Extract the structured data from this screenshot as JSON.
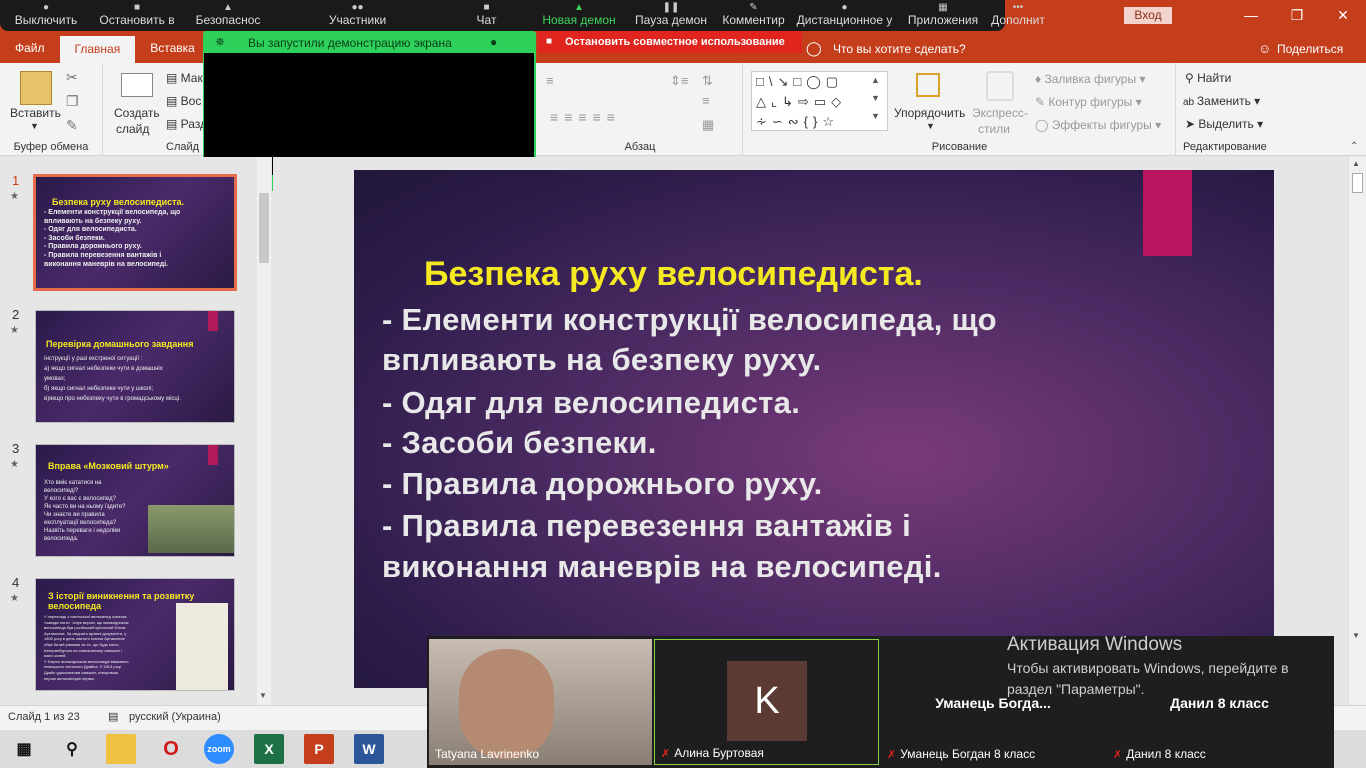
{
  "app": {
    "login": "Вход"
  },
  "zoom_toolbar": {
    "items": [
      "Выключить",
      "Остановить в",
      "Безопаснос",
      "Участники",
      "Чат",
      "Новая демон",
      "Пауза демон",
      "Комментир",
      "Дистанционное у",
      "Приложения",
      "Дополнит"
    ],
    "active_item": "Новая демон"
  },
  "share_bar": {
    "title": "Вы запустили демонстрацию экрана",
    "stop_label": "Остановить совместное использование"
  },
  "tabs": {
    "items": [
      "Файл",
      "Главная",
      "Вставка"
    ],
    "active": "Главная",
    "tell_me": "Что вы хотите сделать?",
    "share": "Поделиться"
  },
  "ribbon": {
    "paste": "Вставить",
    "clipboard_label": "Буфер обмена",
    "new_slide_1": "Создать",
    "new_slide_2": "слайд",
    "layout": "Мак",
    "reset": "Вос",
    "section": "Разд",
    "slides_label": "Слайд",
    "paragraph_label": "Абзац",
    "arrange_label": "Упорядочить",
    "quick_styles_1": "Экспресс-",
    "quick_styles_2": "стили",
    "shape_fill": "Заливка фигуры",
    "shape_outline": "Контур фигуры",
    "shape_effects": "Эффекты фигуры",
    "drawing_label": "Рисование",
    "find": "Найти",
    "replace": "Заменить",
    "select": "Выделить",
    "editing_label": "Редактирование"
  },
  "thumbnails": [
    {
      "num": "1",
      "title": "Безпека руху велосипедиста.",
      "body": [
        "- Елементи конструкції велосипеда, що",
        "впливають на безпеку руху.",
        "- Одяг для велосипедиста.",
        "- Засоби безпеки.",
        "- Правила дорожнього руху.",
        "- Правила перевезення вантажів і",
        "виконання маневрів на велосипеді."
      ]
    },
    {
      "num": "2",
      "title": "Перевірка домашнього завдання",
      "body": [
        "Інструкції у разі екстреної ситуації :",
        "а) якщо сигнал небезпеки чути в домашніх",
        "умовах;",
        "б) якщо сигнал небезпеки чути у школі;",
        "в)якщо про небезпеку чути в громадському місці."
      ]
    },
    {
      "num": "3",
      "title": "Вправа «Мозковий штурм»",
      "body": [
        "Хто вміє кататися на",
        "велосипеді?",
        "У кого є вас є велосипед?",
        "Як часто ви на ньому їздите?",
        "Чи знаєте ви правила",
        "експлуатації велосипеда?",
        "Назвіть переваги і недоліки",
        "велосипеда."
      ]
    },
    {
      "num": "4",
      "title": "З історії виникнення та розвитку велосипеда",
      "body": [
        "У перекладі з латинської велосипед означає",
        "«швидкі ноги». Існує версія, що винахідником",
        "велосипеда був російський кріпосний Юхим",
        "Артамонов. За свідчать архівні документи, у",
        "1800 році в день святого Іоанна Артамонов",
        "обув битий рівнами за те, що будь місто",
        "Катеринбургом на самоковному самокаті і",
        "мало коней.",
        "У Європі винахідником велосипеда вважають",
        "німецького лісничого Драйса. У 1813 році",
        "Драйс удосконалив самокат, створивши",
        "перше велосипедне керма."
      ]
    }
  ],
  "slide": {
    "title": "Безпека руху велосипедиста.",
    "lines": [
      "- Елементи конструкції велосипеда, що",
      "впливають на безпеку руху.",
      "- Одяг для велосипедиста.",
      "- Засоби безпеки.",
      "- Правила дорожнього руху.",
      "- Правила перевезення вантажів і",
      "виконання маневрів на велосипеді."
    ]
  },
  "status": {
    "slide": "Слайд 1 из 23",
    "language": "русский (Украина)"
  },
  "participants": [
    {
      "name": "Tatyana Lavrinenko",
      "muted": false
    },
    {
      "name": "Алина Буртовая",
      "muted": true,
      "initial": "K"
    },
    {
      "name": "Уманець Богдан 8 класс",
      "muted": true,
      "big": "Уманець  Богда..."
    },
    {
      "name": "Данил 8 класс",
      "muted": true,
      "big": "Данил 8 класс"
    }
  ],
  "watermark": {
    "title": "Активация Windows",
    "line1": "Чтобы активировать Windows, перейдите в",
    "line2": "раздел \"Параметры\"."
  },
  "taskbar": {
    "zoom": "zoom"
  },
  "colors": {
    "accent": "#c43e1c",
    "zoom_green": "#2ed25a",
    "stop_red": "#e0251f",
    "slide_title": "#f5ea21",
    "slide_accent": "#b8155e"
  }
}
